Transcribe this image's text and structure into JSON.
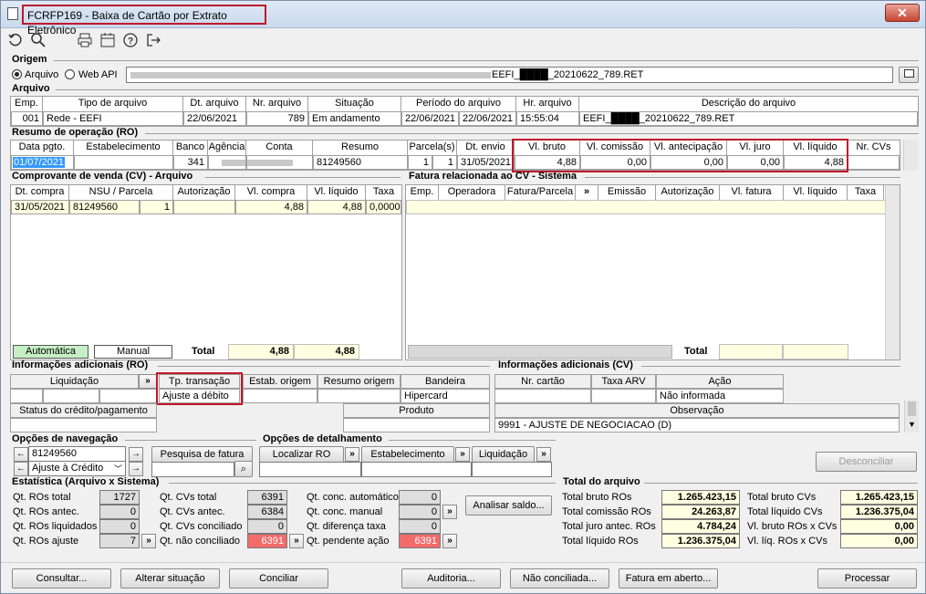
{
  "window": {
    "title": "FCRFP169 - Baixa de Cartão por Extrato Eletrônico",
    "close": "✕"
  },
  "toolbar": {
    "icons": [
      "refresh-icon",
      "search-icon",
      "print-icon",
      "calendar-icon",
      "help-icon",
      "exit-icon"
    ]
  },
  "origem": {
    "section": "Origem",
    "opt_arquivo": "Arquivo",
    "opt_webapi": "Web API",
    "path": "EEFI_████_20210622_789.RET"
  },
  "arquivo": {
    "section": "Arquivo",
    "headers": [
      "Emp.",
      "Tipo de arquivo",
      "Dt. arquivo",
      "Nr. arquivo",
      "Situação",
      "Período do arquivo",
      "Hr. arquivo",
      "Descrição do arquivo"
    ],
    "row": {
      "emp": "001",
      "tipo": "Rede - EEFI",
      "dt": "22/06/2021",
      "nr": "789",
      "situacao": "Em andamento",
      "periodo_ini": "22/06/2021",
      "periodo_fim": "22/06/2021",
      "hr": "15:55:04",
      "desc": "EEFI_████_20210622_789.RET"
    }
  },
  "ro": {
    "section": "Resumo de operação (RO)",
    "headers": [
      "Data pgto.",
      "Estabelecimento",
      "Banco",
      "Agência",
      "Conta",
      "Resumo",
      "Parcela(s)",
      "Dt. envio",
      "Vl. bruto",
      "Vl. comissão",
      "Vl. antecipação",
      "Vl. juro",
      "Vl. líquido",
      "Nr. CVs"
    ],
    "row": {
      "data": "01/07/2021",
      "estab": "",
      "banco": "341",
      "agencia": "",
      "conta": "",
      "resumo": "81249560",
      "parc1": "1",
      "parc2": "1",
      "dt_envio": "31/05/2021",
      "bruto": "4,88",
      "comissao": "0,00",
      "antecip": "0,00",
      "juro": "0,00",
      "liquido": "4,88",
      "ncvs": ""
    }
  },
  "cv": {
    "section": "Comprovante de venda (CV) - Arquivo",
    "headers": [
      "Dt. compra",
      "NSU / Parcela",
      "Autorização",
      "Vl. compra",
      "Vl. líquido",
      "Taxa"
    ],
    "row": {
      "dt": "31/05/2021",
      "nsu": "81249560",
      "parc": "1",
      "aut": "",
      "compra": "4,88",
      "liquido": "4,88",
      "taxa": "0,0000"
    },
    "legend_auto": "Automática",
    "legend_manual": "Manual",
    "total_label": "Total",
    "total_compra": "4,88",
    "total_liquido": "4,88"
  },
  "fatura": {
    "section": "Fatura relacionada ao CV - Sistema",
    "headers": [
      "Emp.",
      "Operadora",
      "Fatura/Parcela",
      "»",
      "Emissão",
      "Autorização",
      "Vl. fatura",
      "Vl. líquido",
      "Taxa"
    ],
    "total_label": "Total"
  },
  "info_ro": {
    "section": "Informações adicionais (RO)",
    "liquidacao": "Liquidação",
    "expand": "»",
    "tp_transacao": "Tp. transação",
    "tp_value": "Ajuste a débito",
    "estab_origem": "Estab. origem",
    "resumo_origem": "Resumo origem",
    "bandeira": "Bandeira",
    "bandeira_value": "Hipercard",
    "status": "Status do crédito/pagamento",
    "produto": "Produto"
  },
  "info_cv": {
    "section": "Informações adicionais (CV)",
    "nr_cartao": "Nr. cartão",
    "taxa_arv": "Taxa ARV",
    "acao": "Ação",
    "acao_value": "Não informada",
    "observacao": "Observação",
    "obs_value": "9991 - AJUSTE DE NEGOCIACAO (D)"
  },
  "nav": {
    "section": "Opções de navegação",
    "value": "81249560",
    "select": "Ajuste à Crédito",
    "pesquisa": "Pesquisa de fatura"
  },
  "detail": {
    "section": "Opções de detalhamento",
    "localizar": "Localizar RO",
    "estab": "Estabelecimento",
    "liquidacao": "Liquidação"
  },
  "desconciliar": "Desconciliar",
  "stats": {
    "section": "Estatística (Arquivo x Sistema)",
    "c1": [
      {
        "label": "Qt. ROs total",
        "value": "1727"
      },
      {
        "label": "Qt. ROs antec.",
        "value": "0"
      },
      {
        "label": "Qt. ROs liquidados",
        "value": "0"
      },
      {
        "label": "Qt. ROs ajuste",
        "value": "7"
      }
    ],
    "c2": [
      {
        "label": "Qt. CVs total",
        "value": "6391"
      },
      {
        "label": "Qt. CVs antec.",
        "value": "6384"
      },
      {
        "label": "Qt. CVs conciliado",
        "value": "0"
      },
      {
        "label": "Qt. não conciliado",
        "value": "6391"
      }
    ],
    "c3": [
      {
        "label": "Qt. conc. automático",
        "value": "0"
      },
      {
        "label": "Qt. conc. manual",
        "value": "0"
      },
      {
        "label": "Qt. diferença taxa",
        "value": "0"
      },
      {
        "label": "Qt. pendente ação",
        "value": "6391"
      }
    ],
    "analisar": "Analisar saldo..."
  },
  "totals": {
    "section": "Total do arquivo",
    "left": [
      {
        "label": "Total bruto ROs",
        "value": "1.265.423,15"
      },
      {
        "label": "Total comissão ROs",
        "value": "24.263,87"
      },
      {
        "label": "Total juro antec. ROs",
        "value": "4.784,24"
      },
      {
        "label": "Total líquido ROs",
        "value": "1.236.375,04"
      }
    ],
    "right": [
      {
        "label": "Total bruto CVs",
        "value": "1.265.423,15"
      },
      {
        "label": "Total líquido CVs",
        "value": "1.236.375,04"
      },
      {
        "label": "Vl. bruto ROs x CVs",
        "value": "0,00"
      },
      {
        "label": "Vl. líq. ROs x CVs",
        "value": "0,00"
      }
    ]
  },
  "footer": [
    "Consultar...",
    "Alterar situação",
    "Conciliar",
    "Auditoria...",
    "Não conciliada...",
    "Fatura em aberto...",
    "Processar"
  ]
}
